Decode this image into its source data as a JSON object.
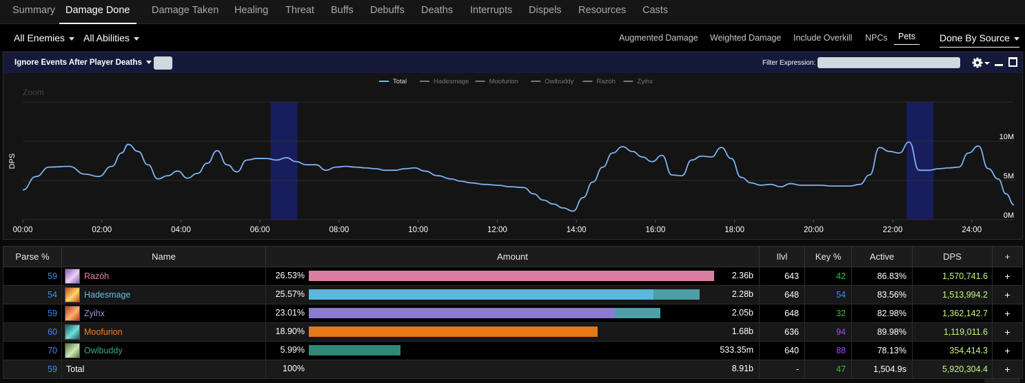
{
  "tabs": [
    {
      "label": "Summary",
      "active": false
    },
    {
      "label": "Damage Done",
      "active": true
    },
    {
      "label": "Damage Taken",
      "active": false
    },
    {
      "label": "Healing",
      "active": false
    },
    {
      "label": "Threat",
      "active": false
    },
    {
      "label": "Buffs",
      "active": false
    },
    {
      "label": "Debuffs",
      "active": false
    },
    {
      "label": "Deaths",
      "active": false
    },
    {
      "label": "Interrupts",
      "active": false
    },
    {
      "label": "Dispels",
      "active": false
    },
    {
      "label": "Resources",
      "active": false
    },
    {
      "label": "Casts",
      "active": false
    }
  ],
  "filters": {
    "enemies": "All Enemies",
    "abilities": "All Abilities",
    "options": [
      "Augmented Damage",
      "Weighted Damage",
      "Include Overkill",
      "NPCs",
      "Pets"
    ],
    "selected_option": "Pets",
    "done_by": "Done By Source"
  },
  "panel": {
    "ignore_events": "Ignore Events After Player Deaths",
    "filter_label": "Filter Expression:",
    "filter_value": ""
  },
  "chart_data": {
    "type": "line",
    "zoom_label": "Zoom",
    "ylabel": "DPS",
    "legend": [
      "Total",
      "Hadesmage",
      "Moofurion",
      "Owlbuddy",
      "Razóh",
      "Zyihx"
    ],
    "x_ticks": [
      "00:00",
      "02:00",
      "04:00",
      "06:00",
      "08:00",
      "10:00",
      "12:00",
      "14:00",
      "16:00",
      "18:00",
      "20:00",
      "22:00",
      "24:00"
    ],
    "y_ticks": [
      "0M",
      "5M",
      "10M"
    ],
    "ylim": [
      0,
      15000000
    ],
    "xlim_seconds": [
      0,
      1504
    ],
    "highlight_ranges_seconds": [
      [
        376,
        417
      ],
      [
        1341,
        1382
      ]
    ],
    "series": [
      {
        "name": "Total",
        "color": "#7eb3f2",
        "points_seconds_dps": [
          [
            0,
            3800000.0
          ],
          [
            20,
            5500000.0
          ],
          [
            40,
            6700000.0
          ],
          [
            70,
            6800000.0
          ],
          [
            95,
            5800000.0
          ],
          [
            115,
            5500000.0
          ],
          [
            135,
            6800000.0
          ],
          [
            150,
            8500000.0
          ],
          [
            160,
            9600000.0
          ],
          [
            175,
            8700000.0
          ],
          [
            190,
            7000000.0
          ],
          [
            205,
            5200000.0
          ],
          [
            220,
            5600000.0
          ],
          [
            235,
            6200000.0
          ],
          [
            250,
            5300000.0
          ],
          [
            265,
            5900000.0
          ],
          [
            280,
            7200000.0
          ],
          [
            295,
            8800000.0
          ],
          [
            310,
            7000000.0
          ],
          [
            325,
            6100000.0
          ],
          [
            340,
            7600000.0
          ],
          [
            355,
            7800000.0
          ],
          [
            370,
            7800000.0
          ],
          [
            385,
            7600000.0
          ],
          [
            400,
            7900000.0
          ],
          [
            415,
            7400000.0
          ],
          [
            430,
            7000000.0
          ],
          [
            445,
            7000000.0
          ],
          [
            460,
            6300000.0
          ],
          [
            475,
            6700000.0
          ],
          [
            490,
            6800000.0
          ],
          [
            505,
            6700000.0
          ],
          [
            520,
            6600000.0
          ],
          [
            535,
            6500000.0
          ],
          [
            550,
            6300000.0
          ],
          [
            565,
            6300000.0
          ],
          [
            580,
            6500000.0
          ],
          [
            595,
            6600000.0
          ],
          [
            610,
            6200000.0
          ],
          [
            630,
            5600000.0
          ],
          [
            650,
            5200000.0
          ],
          [
            665,
            4900000.0
          ],
          [
            680,
            4700000.0
          ],
          [
            700,
            4500000.0
          ],
          [
            720,
            4400000.0
          ],
          [
            740,
            4200000.0
          ],
          [
            760,
            4100000.0
          ],
          [
            775,
            3300000.0
          ],
          [
            790,
            2500000.0
          ],
          [
            805,
            2000000.0
          ],
          [
            820,
            1500000.0
          ],
          [
            835,
            1100000.0
          ],
          [
            850,
            2800000.0
          ],
          [
            865,
            4800000.0
          ],
          [
            880,
            6700000.0
          ],
          [
            895,
            8500000.0
          ],
          [
            910,
            9300000.0
          ],
          [
            925,
            8700000.0
          ],
          [
            940,
            8000000.0
          ],
          [
            955,
            7400000.0
          ],
          [
            970,
            8200000.0
          ],
          [
            985,
            5700000.0
          ],
          [
            1000,
            5600000.0
          ],
          [
            1015,
            7600000.0
          ],
          [
            1030,
            8100000.0
          ],
          [
            1045,
            8000000.0
          ],
          [
            1060,
            9200000.0
          ],
          [
            1075,
            7800000.0
          ],
          [
            1090,
            5400000.0
          ],
          [
            1105,
            4700000.0
          ],
          [
            1120,
            4400000.0
          ],
          [
            1135,
            4500000.0
          ],
          [
            1150,
            4200000.0
          ],
          [
            1165,
            4600000.0
          ],
          [
            1180,
            4400000.0
          ],
          [
            1195,
            4400000.0
          ],
          [
            1210,
            4400000.0
          ],
          [
            1225,
            4300000.0
          ],
          [
            1240,
            4300000.0
          ],
          [
            1255,
            4300000.0
          ],
          [
            1270,
            4500000.0
          ],
          [
            1285,
            5700000.0
          ],
          [
            1300,
            9200000.0
          ],
          [
            1315,
            8700000.0
          ],
          [
            1330,
            8500000.0
          ],
          [
            1345,
            9900000.0
          ],
          [
            1360,
            6300000.0
          ],
          [
            1375,
            6300000.0
          ],
          [
            1390,
            6500000.0
          ],
          [
            1405,
            6600000.0
          ],
          [
            1420,
            6700000.0
          ],
          [
            1435,
            8500000.0
          ],
          [
            1450,
            9400000.0
          ],
          [
            1465,
            6500000.0
          ],
          [
            1480,
            5200000.0
          ],
          [
            1492,
            3300000.0
          ],
          [
            1504,
            1900000.0
          ]
        ]
      }
    ]
  },
  "table": {
    "headers": [
      "Parse %",
      "Name",
      "Amount",
      "Ilvl",
      "Key %",
      "Active",
      "DPS",
      "+"
    ],
    "rows": [
      {
        "parse": "59",
        "name": "Razóh",
        "name_color": "#e382a6",
        "avatar_colors": [
          "#8a5ab8",
          "#e8d2f5"
        ],
        "pct": "26.53%",
        "bar1_frac": 1.0,
        "bar1_color": "#db7ea4",
        "bar2_frac": 0.0,
        "bar2_color": "#3d8f97",
        "amount": "2.36b",
        "ilvl": "643",
        "key": "42",
        "key_color": "#2ec13c",
        "active": "86.83%",
        "dps": "1,570,741.6",
        "plus": "+"
      },
      {
        "parse": "54",
        "name": "Hadesmage",
        "name_color": "#61c2e6",
        "avatar_colors": [
          "#c64a12",
          "#ffd66b"
        ],
        "pct": "25.57%",
        "bar1_frac": 0.85,
        "bar1_color": "#5bb7db",
        "bar2_frac": 0.114,
        "bar2_color": "#4f9ea6",
        "amount": "2.28b",
        "ilvl": "648",
        "key": "54",
        "key_color": "#3a8bff",
        "active": "83.56%",
        "dps": "1,513,994.2",
        "plus": "+"
      },
      {
        "parse": "59",
        "name": "Zyihx",
        "name_color": "#a58ee6",
        "avatar_colors": [
          "#b7381e",
          "#ffb26e"
        ],
        "pct": "23.01%",
        "bar1_frac": 0.755,
        "bar1_color": "#8c7bd0",
        "bar2_frac": 0.112,
        "bar2_color": "#4f9ea6",
        "amount": "2.05b",
        "ilvl": "648",
        "key": "32",
        "key_color": "#2ec13c",
        "active": "82.98%",
        "dps": "1,362,142.7",
        "plus": "+"
      },
      {
        "parse": "60",
        "name": "Moofurion",
        "name_color": "#f08223",
        "avatar_colors": [
          "#1b5a5f",
          "#6fe0d9"
        ],
        "pct": "18.90%",
        "bar1_frac": 0.713,
        "bar1_color": "#e57818",
        "bar2_frac": 0.0,
        "bar2_color": "#4f9ea6",
        "amount": "1.68b",
        "ilvl": "636",
        "key": "94",
        "key_color": "#a24bf2",
        "active": "89.98%",
        "dps": "1,119,011.6",
        "plus": "+"
      },
      {
        "parse": "70",
        "name": "Owlbuddy",
        "name_color": "#3aa68a",
        "avatar_colors": [
          "#4f7a3a",
          "#cfe7b9"
        ],
        "pct": "5.99%",
        "bar1_frac": 0.226,
        "bar1_color": "#2e8a74",
        "bar2_frac": 0.0,
        "bar2_color": "#4f9ea6",
        "amount": "533.35m",
        "ilvl": "640",
        "key": "88",
        "key_color": "#a24bf2",
        "active": "78.13%",
        "dps": "354,414.3",
        "plus": "+"
      }
    ],
    "total": {
      "parse": "59",
      "name": "Total",
      "pct": "100%",
      "amount": "8.91b",
      "ilvl": "-",
      "key": "47",
      "key_color": "#2ec13c",
      "active": "1,504.9s",
      "dps": "5,920,304.4",
      "plus": "+"
    }
  }
}
